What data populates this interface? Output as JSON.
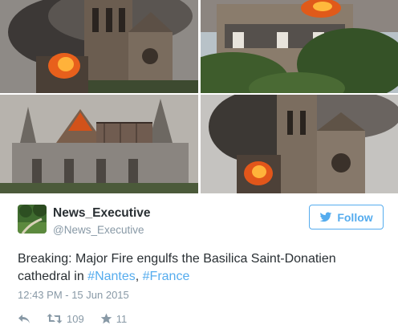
{
  "tweet": {
    "display_name": "News_Executive",
    "handle": "@News_Executive",
    "follow_label": "Follow",
    "text_plain": "Breaking: Major Fire engulfs the Basilica Saint-Donatien cathedral in ",
    "hashtags": [
      "#Nantes",
      "#France"
    ],
    "separator": ", ",
    "timestamp": "12:43 PM - 15 Jun 2015",
    "retweet_count": "109",
    "favorite_count": "11"
  },
  "photos": [
    {
      "name": "photo-1",
      "subject": "cathedral tower on fire, smoke"
    },
    {
      "name": "photo-2",
      "subject": "cathedral roof on fire above houses"
    },
    {
      "name": "photo-3",
      "subject": "cathedral spire burning, scaffold"
    },
    {
      "name": "photo-4",
      "subject": "cathedral facade with fire and smoke"
    }
  ],
  "icons": {
    "follow": "bird-icon",
    "reply": "reply-icon",
    "retweet": "retweet-icon",
    "favorite": "star-icon"
  },
  "colors": {
    "accent": "#55acee",
    "text": "#292f33",
    "muted": "#8899a6"
  }
}
